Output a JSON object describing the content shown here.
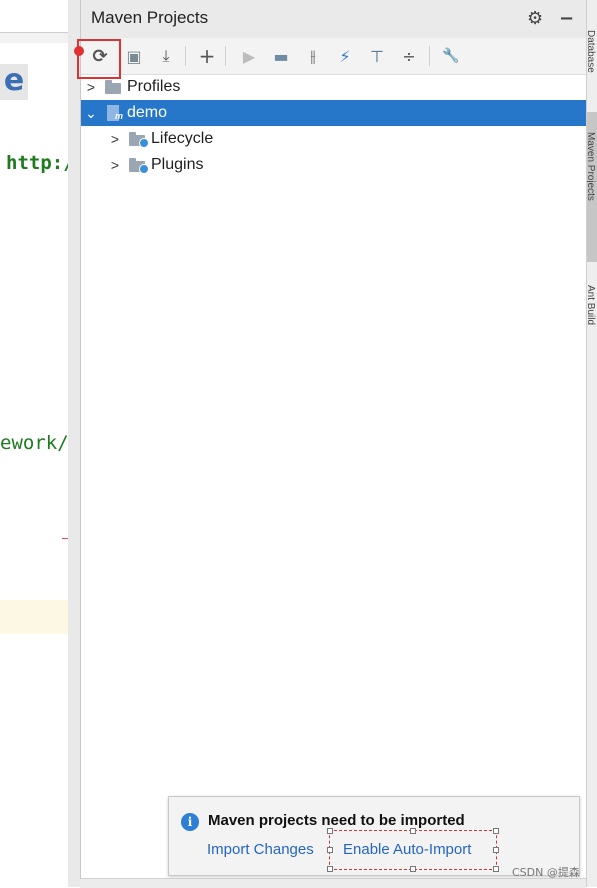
{
  "editor": {
    "letter": "e",
    "code_line_1": "http:/",
    "code_line_2": "ework/s"
  },
  "panel": {
    "title": "Maven Projects",
    "header_icons": [
      "gear-icon",
      "minimize-icon"
    ]
  },
  "toolbar": {
    "buttons": [
      {
        "name": "reimport-icon",
        "glyph": "⟳"
      },
      {
        "name": "generate-sources-icon",
        "glyph": "▣"
      },
      {
        "name": "download-icon",
        "glyph": "⤓"
      },
      {
        "name": "add-icon",
        "glyph": "+"
      },
      {
        "name": "run-icon",
        "glyph": "▶"
      },
      {
        "name": "execute-goal-icon",
        "glyph": "▬"
      },
      {
        "name": "toggle-offline-icon",
        "glyph": "⫲"
      },
      {
        "name": "skip-tests-icon",
        "glyph": "⚡"
      },
      {
        "name": "show-dependencies-icon",
        "glyph": "⊤"
      },
      {
        "name": "collapse-all-icon",
        "glyph": "÷"
      },
      {
        "name": "settings-wrench-icon",
        "glyph": "🔧"
      }
    ]
  },
  "tree": {
    "items": [
      {
        "label": "Profiles",
        "level": 0,
        "expanded": false,
        "selected": false
      },
      {
        "label": "demo",
        "level": 0,
        "expanded": true,
        "selected": true
      },
      {
        "label": "Lifecycle",
        "level": 1,
        "expanded": false,
        "selected": false
      },
      {
        "label": "Plugins",
        "level": 1,
        "expanded": false,
        "selected": false
      }
    ]
  },
  "notification": {
    "title": "Maven projects need to be imported",
    "import_changes": "Import Changes",
    "enable_auto_import": "Enable Auto-Import"
  },
  "watermark": "CSDN @提森",
  "colors": {
    "selection": "#2677c9",
    "link": "#2466c2",
    "highlight_red": "#e03030",
    "info_blue": "#2d7fd3"
  }
}
